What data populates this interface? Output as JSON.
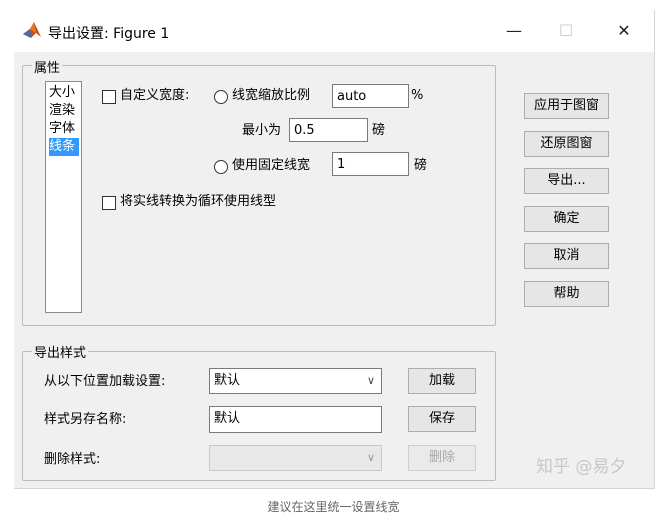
{
  "window": {
    "title": "导出设置: Figure 1",
    "minimize": "—",
    "maximize": "☐",
    "close": "✕"
  },
  "properties": {
    "legend": "属性",
    "list": [
      "大小",
      "渲染",
      "字体",
      "线条"
    ],
    "selected_index": 3,
    "custom_width_label": "自定义宽度:",
    "scale_radio_label": "线宽缩放比例",
    "scale_value": "auto",
    "percent": "%",
    "min_label": "最小为",
    "min_value": "0.5",
    "pound_unit": "磅",
    "fixed_radio_label": "使用固定线宽",
    "fixed_value": "1",
    "fixed_unit": "磅",
    "convert_label": "将实线转换为循环使用线型"
  },
  "side_buttons": {
    "apply": "应用于图窗",
    "restore": "还原图窗",
    "export": "导出...",
    "ok": "确定",
    "cancel": "取消",
    "help": "帮助"
  },
  "export_style": {
    "legend": "导出样式",
    "load_label": "从以下位置加载设置:",
    "load_value": "默认",
    "load_button": "加载",
    "save_as_label": "样式另存名称:",
    "save_as_value": "默认",
    "save_button": "保存",
    "delete_label": "删除样式:",
    "delete_value": "",
    "delete_button": "删除"
  },
  "watermark": "知乎 @易夕",
  "caption": "建议在这里统一设置线宽",
  "colors": {
    "selection": "#3399ff",
    "dialog_bg": "#f0f0f0"
  }
}
